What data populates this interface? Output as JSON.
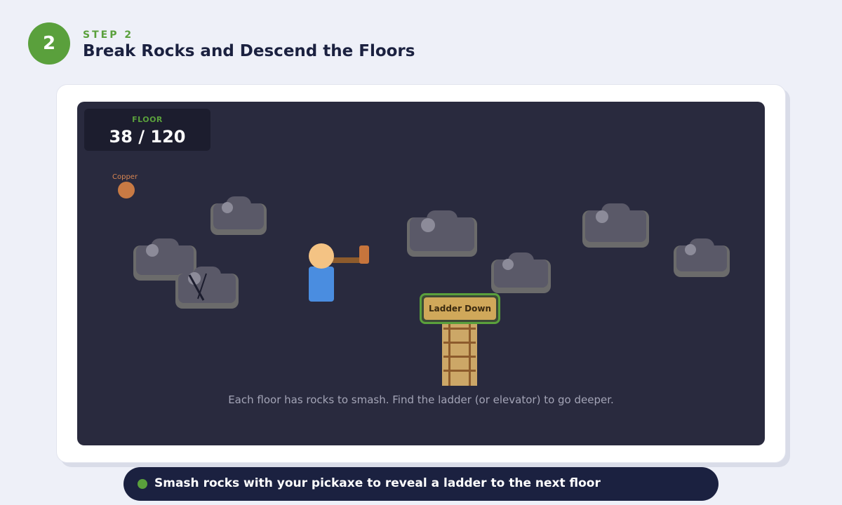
{
  "step": {
    "number": "2",
    "label": "STEP 2",
    "title": "Break Rocks and Descend the Floors"
  },
  "game": {
    "floor_label": "FLOOR",
    "floor_value": "38 / 120",
    "ore_label": "Copper",
    "ladder_label": "Ladder Down",
    "hint": "Each floor has rocks to smash. Find the ladder (or elevator) to go deeper."
  },
  "tip": {
    "text": "Smash rocks with your pickaxe to reveal a ladder to the next floor"
  },
  "colors": {
    "accent": "#5aa03c",
    "navy": "#1b2140",
    "stage_bg": "#292a3e",
    "rock": "#5a5968",
    "ore_copper": "#c87a44"
  }
}
